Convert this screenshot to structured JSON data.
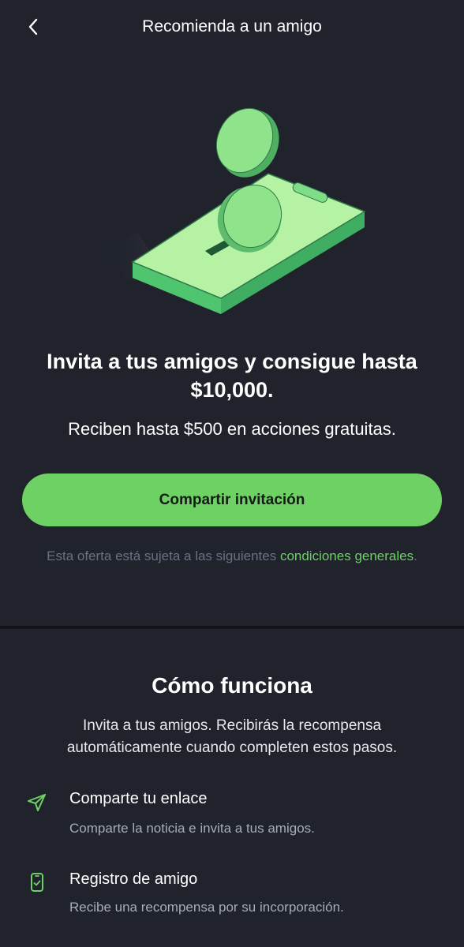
{
  "header": {
    "title": "Recomienda a un amigo",
    "back_icon": "chevron-left-icon"
  },
  "hero": {
    "illustration": "phone-with-coins-illustration",
    "headline_line1": "Invita a tus amigos y consigue hasta",
    "headline_line2": "$10,000.",
    "subheadline": "Reciben hasta $500 en acciones gratuitas."
  },
  "cta": {
    "share_label": "Compartir invitación"
  },
  "terms": {
    "prefix": "Esta oferta está sujeta a las siguientes ",
    "link": "condiciones generales",
    "suffix": "."
  },
  "how_it_works": {
    "title": "Cómo funciona",
    "description": "Invita a tus amigos. Recibirás la recompensa automáticamente cuando completen estos pasos.",
    "steps": [
      {
        "icon": "send-icon",
        "title": "Comparte tu enlace",
        "description": "Comparte la noticia e invita a tus amigos."
      },
      {
        "icon": "phone-check-icon",
        "title": "Registro de amigo",
        "description": "Recibe una recompensa por su incorporación."
      }
    ]
  },
  "colors": {
    "background": "#20232c",
    "divider": "#12141a",
    "accent": "#6dd164",
    "muted_text": "#6b7184"
  }
}
